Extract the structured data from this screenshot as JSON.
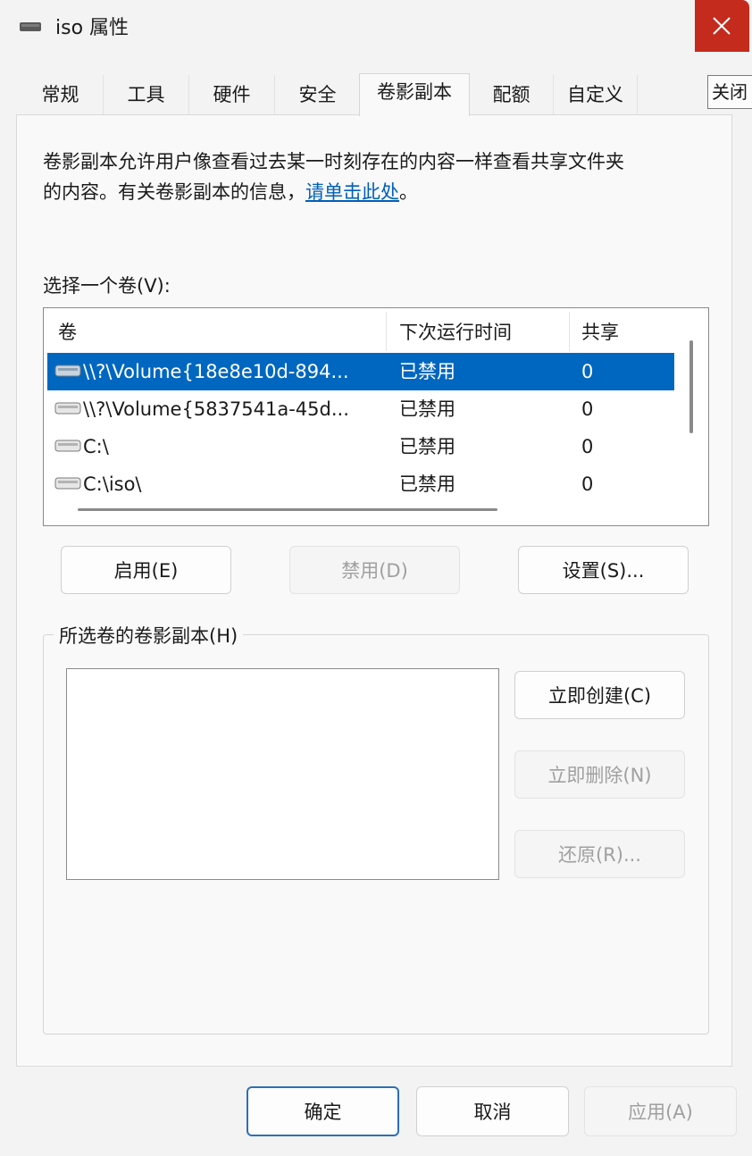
{
  "window": {
    "title": "iso 属性",
    "close_icon": "close-icon",
    "tooltip": "关闭"
  },
  "tabs": [
    {
      "label": "常规",
      "active": false
    },
    {
      "label": "工具",
      "active": false
    },
    {
      "label": "硬件",
      "active": false
    },
    {
      "label": "安全",
      "active": false
    },
    {
      "label": "卷影副本",
      "active": true
    },
    {
      "label": "配额",
      "active": false
    },
    {
      "label": "自定义",
      "active": false
    }
  ],
  "description": {
    "line1": "卷影副本允许用户像查看过去某一时刻存在的内容一样查看共享文件夹",
    "line2_prefix": "的内容。有关卷影副本的信息，",
    "link": "请单击此处",
    "line2_suffix": "。"
  },
  "volume_list": {
    "label": "选择一个卷(V):",
    "columns": [
      "卷",
      "下次运行时间",
      "共享"
    ],
    "rows": [
      {
        "volume": "\\\\?\\Volume{18e8e10d-894...",
        "next_run": "已禁用",
        "shares": "0",
        "selected": true
      },
      {
        "volume": "\\\\?\\Volume{5837541a-45d...",
        "next_run": "已禁用",
        "shares": "0",
        "selected": false
      },
      {
        "volume": "C:\\",
        "next_run": "已禁用",
        "shares": "0",
        "selected": false
      },
      {
        "volume": "C:\\iso\\",
        "next_run": "已禁用",
        "shares": "0",
        "selected": false
      }
    ]
  },
  "volume_buttons": {
    "enable": "启用(E)",
    "disable": "禁用(D)",
    "settings": "设置(S)..."
  },
  "snapshots_group": {
    "title": "所选卷的卷影副本(H)",
    "create_now": "立即创建(C)",
    "delete_now": "立即删除(N)",
    "revert": "还原(R)..."
  },
  "footer": {
    "ok": "确定",
    "cancel": "取消",
    "apply": "应用(A)"
  },
  "colors": {
    "accent": "#0067c0",
    "close": "#c42b1c",
    "link": "#005fb8"
  }
}
